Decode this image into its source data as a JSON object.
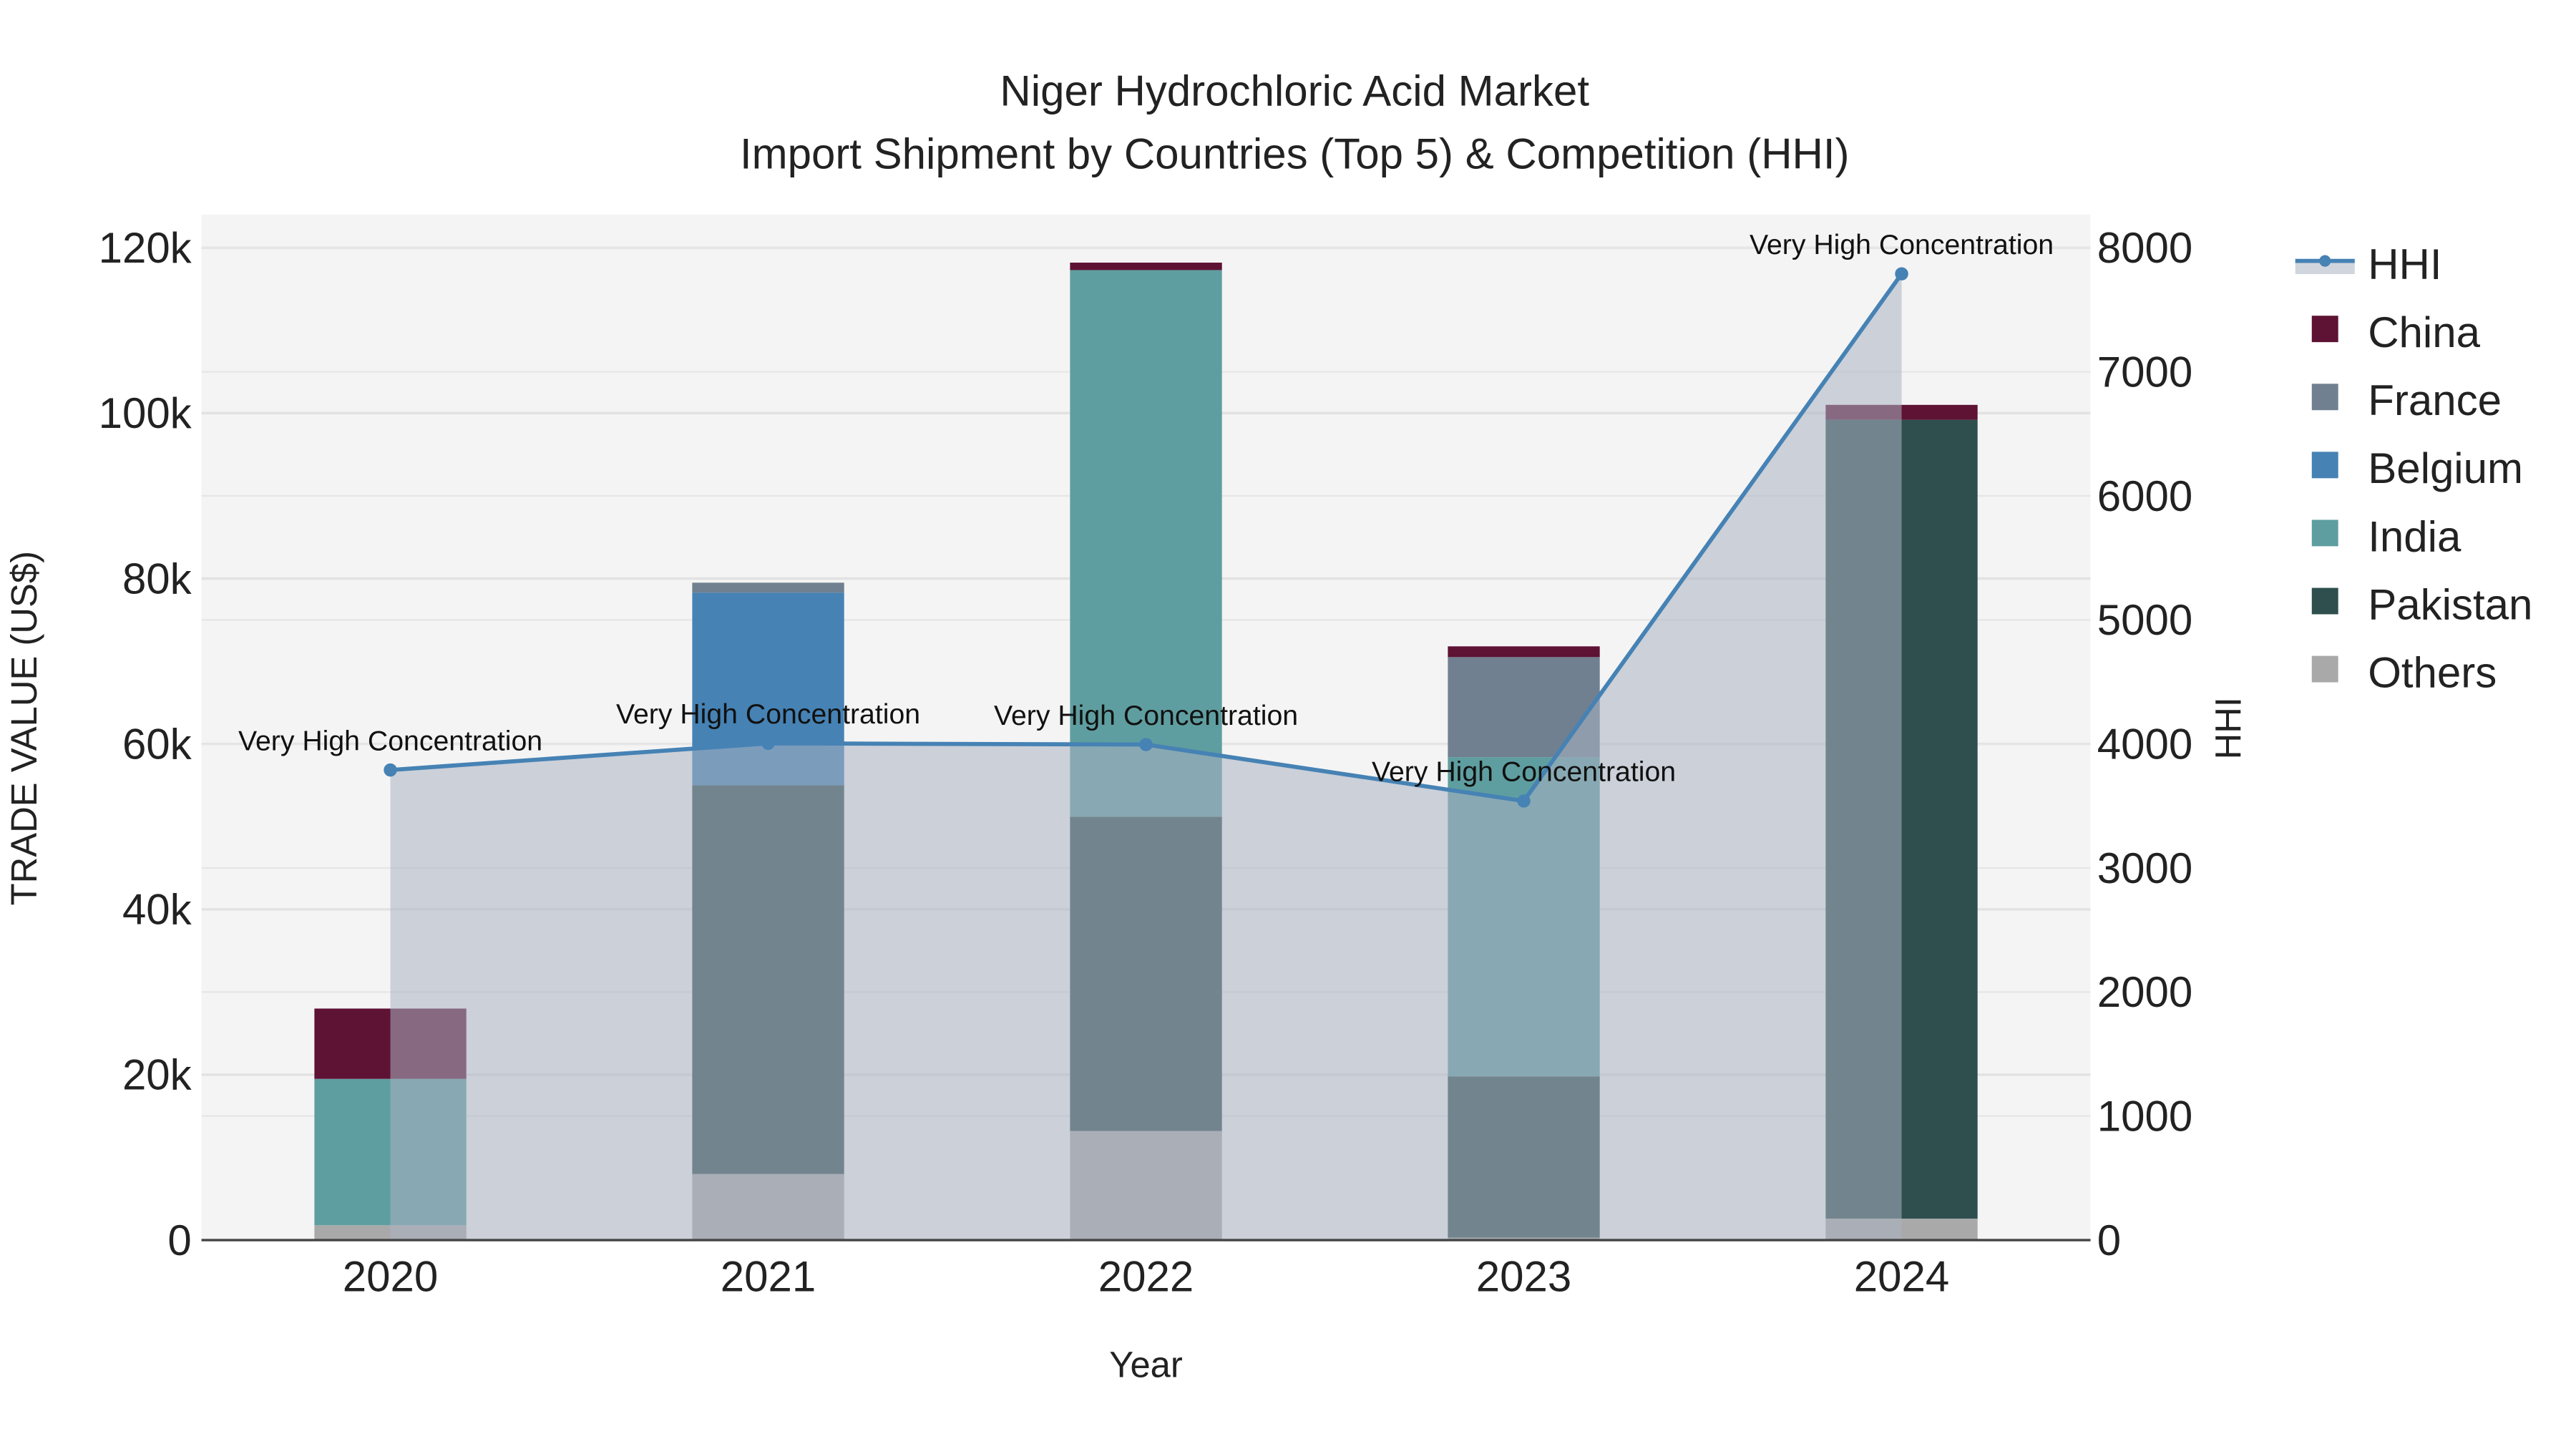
{
  "chart_data": {
    "type": "bar",
    "title": "Niger Hydrochloric Acid Market",
    "subtitle": "Import Shipment by Countries (Top 5) & Competition (HHI)",
    "xlabel": "Year",
    "ylabel": "TRADE VALUE (US$)",
    "y2label": "HHI",
    "categories": [
      "2020",
      "2021",
      "2022",
      "2023",
      "2024"
    ],
    "ylim": [
      0,
      124000
    ],
    "y2lim": [
      0,
      8267
    ],
    "yticks": [
      0,
      20000,
      40000,
      60000,
      80000,
      100000,
      120000
    ],
    "ytick_labels": [
      "0",
      "20k",
      "40k",
      "60k",
      "80k",
      "100k",
      "120k"
    ],
    "y2ticks": [
      0,
      1000,
      2000,
      3000,
      4000,
      5000,
      6000,
      7000,
      8000
    ],
    "y2tick_labels": [
      "0",
      "1000",
      "2000",
      "3000",
      "4000",
      "5000",
      "6000",
      "7000",
      "8000"
    ],
    "grid": true,
    "legend_position": "right",
    "series": [
      {
        "name": "Others",
        "color": "#a9a9a9",
        "values": [
          1800,
          8000,
          13200,
          300,
          2600
        ]
      },
      {
        "name": "Pakistan",
        "color": "#2f4f4f",
        "values": [
          0,
          47000,
          38000,
          19500,
          96600
        ]
      },
      {
        "name": "India",
        "color": "#5f9ea0",
        "values": [
          17700,
          0,
          66100,
          38600,
          0
        ]
      },
      {
        "name": "Belgium",
        "color": "#4682b4",
        "values": [
          0,
          23300,
          0,
          0,
          0
        ]
      },
      {
        "name": "France",
        "color": "#708090",
        "values": [
          0,
          1200,
          0,
          12100,
          0
        ]
      },
      {
        "name": "China",
        "color": "#5e1234",
        "values": [
          8500,
          0,
          900,
          1300,
          1800
        ]
      }
    ],
    "hhi": {
      "name": "HHI",
      "color": "#4682b4",
      "values": [
        3790,
        4005,
        3995,
        3540,
        7790
      ]
    },
    "annotations": [
      "Very High Concentration",
      "Very High Concentration",
      "Very High Concentration",
      "Very High Concentration",
      "Very High Concentration"
    ],
    "legend_order": [
      "HHI",
      "China",
      "France",
      "Belgium",
      "India",
      "Pakistan",
      "Others"
    ]
  }
}
